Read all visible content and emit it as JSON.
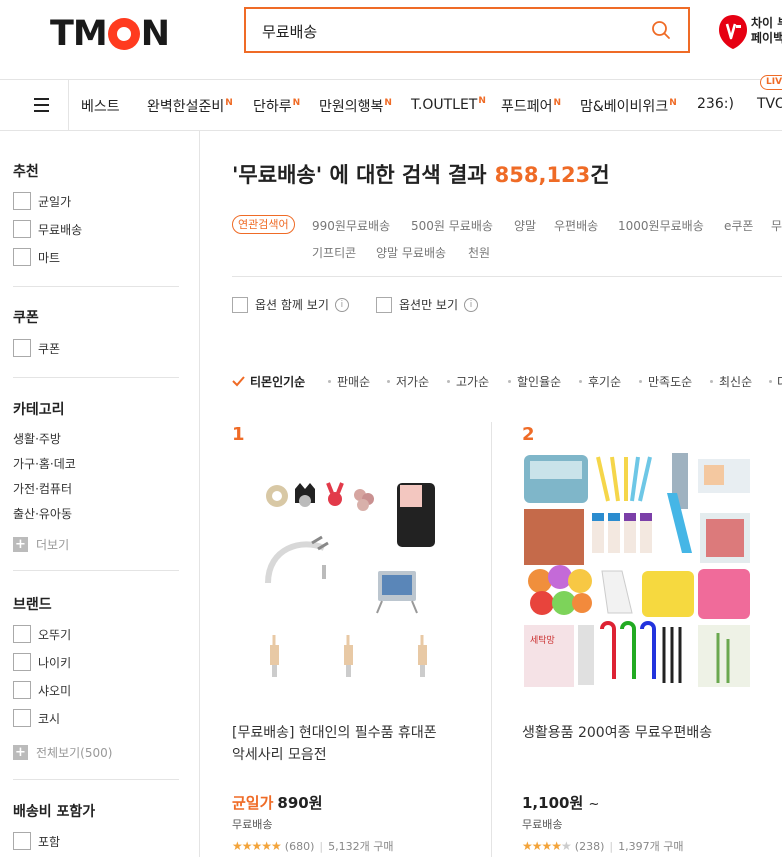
{
  "header": {
    "logo": "TMON",
    "search_value": "무료배송",
    "promo_text_1": "차이 부",
    "promo_text_2": "페이백"
  },
  "nav": {
    "items": [
      "베스트",
      "완벽한설준비",
      "단하루",
      "만원의행복",
      "T.OUTLET",
      "푸드페어",
      "맘&베이비위크",
      "236:)",
      "TVO"
    ],
    "new_mark": "N",
    "live_badge": "LIV"
  },
  "sidebar": {
    "recommend": {
      "title": "추천",
      "items": [
        "균일가",
        "무료배송",
        "마트"
      ]
    },
    "coupon": {
      "title": "쿠폰",
      "items": [
        "쿠폰"
      ]
    },
    "category": {
      "title": "카테고리",
      "items": [
        "생활·주방",
        "가구·홈·데코",
        "가전·컴퓨터",
        "출산·유아동"
      ],
      "more": "더보기"
    },
    "brand": {
      "title": "브랜드",
      "items": [
        "오뚜기",
        "나이키",
        "샤오미",
        "코시"
      ],
      "more": "전체보기(500)"
    },
    "shipping": {
      "title": "배송비 포함가",
      "items": [
        "포함"
      ]
    }
  },
  "results": {
    "title_prefix": "'무료배송' 에 대한 검색 결과",
    "count": "858,123",
    "count_suffix": "건",
    "related_tag": "연관검색어",
    "related_row1": [
      "990원무료배송",
      "500원 무료배송",
      "양말",
      "우편배송",
      "1000원무료배송",
      "e쿠폰",
      "무"
    ],
    "related_row2": [
      "기프티콘",
      "양말 무료배송",
      "천원"
    ],
    "options": [
      "옵션 함께 보기",
      "옵션만 보기"
    ],
    "sort": [
      "티몬인기순",
      "판매순",
      "저가순",
      "고가순",
      "할인율순",
      "후기순",
      "만족도순",
      "최신순",
      "더"
    ]
  },
  "products": [
    {
      "rank": "1",
      "name_line1": "[무료배송] 현대인의 필수품 휴대폰",
      "name_line2": "악세사리 모음전",
      "price_label": "균일가",
      "price": "890원",
      "shipping": "무료배송",
      "reviews": "(680)",
      "sold": "5,132개 구매",
      "rating": 4.5
    },
    {
      "rank": "2",
      "name_line1": "생활용품 200여종 무료우편배송",
      "name_line2": "",
      "price_label": "",
      "price": "1,100원",
      "price_tilde": "~",
      "shipping": "무료배송",
      "reviews": "(238)",
      "sold": "1,397개 구매",
      "rating": 4
    }
  ],
  "colors": {
    "accent": "#ef6b26",
    "logo_o": "#ff3b1f",
    "promo": "#e60012"
  }
}
